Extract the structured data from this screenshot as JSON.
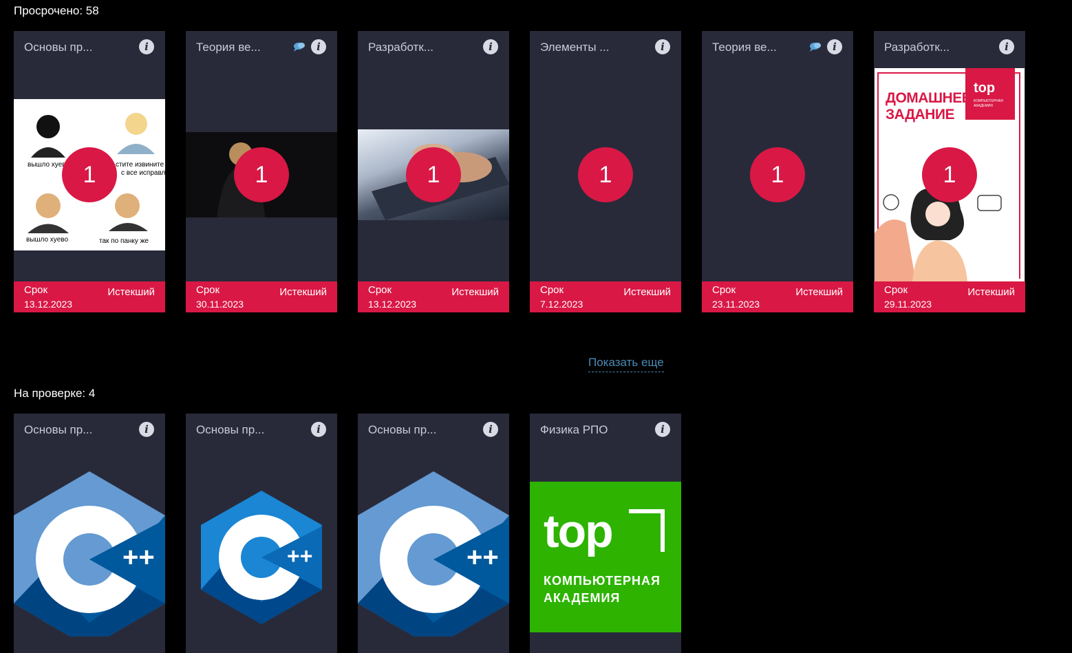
{
  "overdue": {
    "title": "Просрочено: 58",
    "cards": [
      {
        "subject": "Основы пр...",
        "count": "1",
        "deadline_label": "Срок",
        "date": "13.12.2023",
        "status": "Истекший",
        "image": "meme"
      },
      {
        "subject": "Теория ве...",
        "count": "1",
        "deadline_label": "Срок",
        "date": "30.11.2023",
        "status": "Истекший",
        "image": "dark-person",
        "chat": true
      },
      {
        "subject": "Разработк...",
        "count": "1",
        "deadline_label": "Срок",
        "date": "13.12.2023",
        "status": "Истекший",
        "image": "keyboard"
      },
      {
        "subject": "Элементы ...",
        "count": "1",
        "deadline_label": "Срок",
        "date": "7.12.2023",
        "status": "Истекший",
        "image": "none"
      },
      {
        "subject": "Теория ве...",
        "count": "1",
        "deadline_label": "Срок",
        "date": "23.11.2023",
        "status": "Истекший",
        "image": "none",
        "chat": true
      },
      {
        "subject": "Разработк...",
        "count": "1",
        "deadline_label": "Срок",
        "date": "29.11.2023",
        "status": "Истекший",
        "image": "homework-poster"
      }
    ],
    "show_more": "Показать еще"
  },
  "meme_captions": {
    "top_left": "вышло хуев",
    "top_right_1": "стите извините я",
    "top_right_2": "с все исправлю",
    "bottom_left": "вышло хуево",
    "bottom_right": "так по панку же"
  },
  "poster": {
    "line1": "ДОМАШНЕЕ",
    "line2": "ЗАДАНИЕ",
    "logo": "top",
    "logo_sub1": "КОМПЬЮТЕРНАЯ",
    "logo_sub2": "АКАДЕМИЯ"
  },
  "review": {
    "title": "На проверке: 4",
    "cards": [
      {
        "subject": "Основы пр...",
        "image": "cpp-logo"
      },
      {
        "subject": "Основы пр...",
        "image": "cpp-logo"
      },
      {
        "subject": "Основы пр...",
        "image": "cpp-logo"
      },
      {
        "subject": "Физика РПО",
        "image": "top-academy-logo"
      }
    ]
  },
  "top_logo": {
    "word": "top",
    "line1": "КОМПЬЮТЕРНАЯ",
    "line2": "АКАДЕМИЯ"
  },
  "colors": {
    "accent": "#d91845",
    "card_bg": "#282a3a",
    "link": "#4b8ab5",
    "green": "#2db300"
  }
}
